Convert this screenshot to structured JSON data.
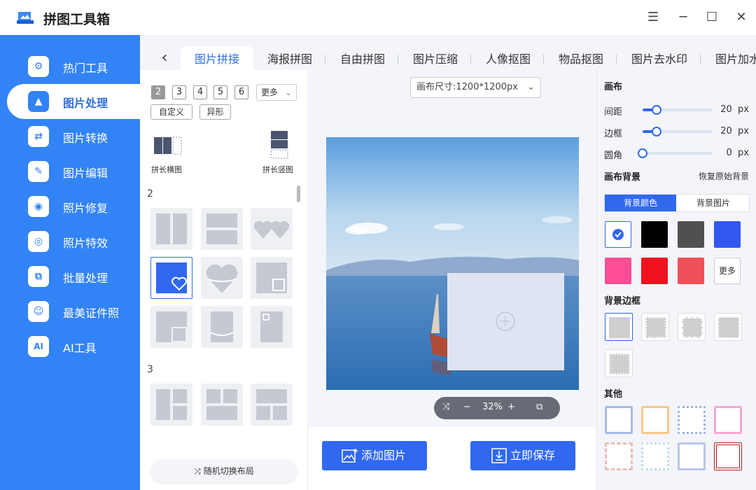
{
  "app": {
    "title": "拼图工具箱"
  },
  "window": {
    "menu_icon": "menu-icon",
    "minimize_icon": "minimize-icon",
    "maximize_icon": "maximize-icon",
    "close_icon": "close-icon"
  },
  "sidebar": {
    "items": [
      {
        "label": "热门工具",
        "icon": "gear-icon"
      },
      {
        "label": "图片处理",
        "icon": "image-clock-icon"
      },
      {
        "label": "图片转换",
        "icon": "image-convert-icon"
      },
      {
        "label": "图片编辑",
        "icon": "image-edit-icon"
      },
      {
        "label": "照片修复",
        "icon": "camera-plus-icon"
      },
      {
        "label": "照片特效",
        "icon": "camera-magic-icon"
      },
      {
        "label": "批量处理",
        "icon": "image-batch-icon"
      },
      {
        "label": "最美证件照",
        "icon": "portrait-icon"
      },
      {
        "label": "AI工具",
        "icon": "ai-icon"
      }
    ],
    "active_index": 1
  },
  "tabs": {
    "items": [
      "图片拼接",
      "海报拼图",
      "自由拼图",
      "图片压缩",
      "人像抠图",
      "物品抠图",
      "图片去水印",
      "图片加水"
    ],
    "active_index": 0
  },
  "layout_panel": {
    "counts": [
      "2",
      "3",
      "4",
      "5",
      "6"
    ],
    "more_label": "更多",
    "custom_label": "自定义",
    "special_label": "异形",
    "long_h_label": "拼长横图",
    "long_v_label": "拼长竖图",
    "section_2": "2",
    "section_3": "3",
    "random_label": "随机切换布局"
  },
  "canvas": {
    "size_label": "画布尺寸:1200*1200px",
    "zoom": "32%"
  },
  "actions": {
    "add_label": "添加图片",
    "save_label": "立即保存"
  },
  "right_panel": {
    "canvas_title": "画布",
    "spacing_label": "间距",
    "spacing_value": "20",
    "spacing_unit": "px",
    "border_label": "边框",
    "border_value": "20",
    "border_unit": "px",
    "radius_label": "圆角",
    "radius_value": "0",
    "radius_unit": "px",
    "bg_title": "画布背景",
    "restore_label": "恢复原始背景",
    "bg_color_tab": "背景颜色",
    "bg_image_tab": "背景图片",
    "colors": [
      "#ffffff",
      "#000000",
      "#505050",
      "#3157f0",
      "#ff4d96",
      "#f0101e",
      "#f0505a"
    ],
    "more_label": "更多",
    "bg_border_title": "背景边框",
    "other_title": "其他",
    "other_colors": [
      "#a9bbe4",
      "#f7c78c",
      "#9ab4f0",
      "#f6a8d0",
      "#e8c0b8",
      "#bfe0e6",
      "#b8c8e8",
      "#b21c1c"
    ]
  }
}
